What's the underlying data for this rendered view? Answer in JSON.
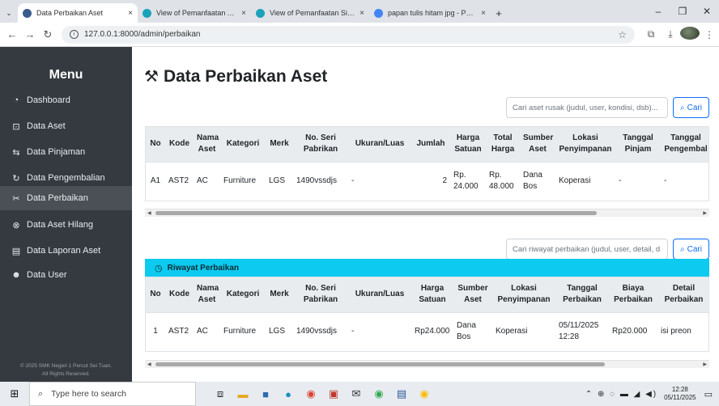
{
  "browser": {
    "tabs": [
      {
        "title": "Data Perbaikan Aset",
        "active": true,
        "favicon_color": "#3b5b8c"
      },
      {
        "title": "View of Pemanfaatan Aplikasi S",
        "active": false,
        "favicon_color": "#1aa2b8"
      },
      {
        "title": "View of Pemanfaatan Sistem Inf",
        "active": false,
        "favicon_color": "#1aa2b8"
      },
      {
        "title": "papan tulis hitam jpg - Penelus",
        "active": false,
        "favicon_color": "#4285f4"
      }
    ],
    "tab_close_glyph": "×",
    "new_tab_glyph": "+",
    "url": "127.0.0.1:8000/admin/perbaikan"
  },
  "sidebar": {
    "title": "Menu",
    "items": [
      {
        "label": "Dashboard",
        "icon": "speedometer-icon",
        "glyph": "◔"
      },
      {
        "label": "Data Aset",
        "icon": "box-icon",
        "glyph": "⊡"
      },
      {
        "label": "Data Pinjaman",
        "icon": "arrow-exchange-icon",
        "glyph": "⇆"
      },
      {
        "label": "Data Pengembalian",
        "icon": "rotate-icon",
        "glyph": "↻"
      },
      {
        "label": "Data Perbaikan",
        "icon": "tools-icon",
        "glyph": "✂"
      },
      {
        "label": "Data Aset Hilang",
        "icon": "x-circle-icon",
        "glyph": "⊗"
      },
      {
        "label": "Data Laporan Aset",
        "icon": "file-icon",
        "glyph": "▤"
      },
      {
        "label": "Data User",
        "icon": "users-icon",
        "glyph": "☻"
      }
    ],
    "active_index": 4,
    "footer_line1": "© 2025 SMK Negeri 1 Percut Sei Tuan.",
    "footer_line2": "All Rights Reserved."
  },
  "main": {
    "title": "Data Perbaikan Aset",
    "search1": {
      "placeholder": "Cari aset rusak (judul, user, kondisi, dsb)...",
      "button": "Cari"
    },
    "table1": {
      "headers": [
        "No",
        "Kode",
        "Nama Aset",
        "Kategori",
        "Merk",
        "No. Seri Pabrikan",
        "Ukuran/Luas",
        "Jumlah",
        "Harga Satuan",
        "Total Harga",
        "Sumber Aset",
        "Lokasi Penyimpanan",
        "Tanggal Pinjam",
        "Tanggal Pengembal"
      ],
      "rows": [
        [
          "A1",
          "AST2",
          "AC",
          "Furniture",
          "LGS",
          "1490vssdjs",
          "-",
          "2",
          "Rp. 24.000",
          "Rp. 48.000",
          "Dana Bos",
          "Koperasi",
          "-",
          "-"
        ]
      ]
    },
    "search2": {
      "placeholder": "Cari riwayat perbaikan (judul, user, detail, d",
      "button": "Cari"
    },
    "riwayat_title": "Riwayat Perbaikan",
    "table2": {
      "headers": [
        "No",
        "Kode",
        "Nama Aset",
        "Kategori",
        "Merk",
        "No. Seri Pabrikan",
        "Ukuran/Luas",
        "Harga Satuan",
        "Sumber Aset",
        "Lokasi Penyimpanan",
        "Tanggal Perbaikan",
        "Biaya Perbaikan",
        "Detail Perbaikan"
      ],
      "rows": [
        [
          "1",
          "AST2",
          "AC",
          "Furniture",
          "LGS",
          "1490vssdjs",
          "-",
          "Rp24.000",
          "Dana Bos",
          "Koperasi",
          "05/11/2025 12:28",
          "Rp20.000",
          "isi preon"
        ]
      ]
    }
  },
  "taskbar": {
    "search_placeholder": "Type here to search",
    "time": "12:28",
    "date": "05/11/2025"
  }
}
